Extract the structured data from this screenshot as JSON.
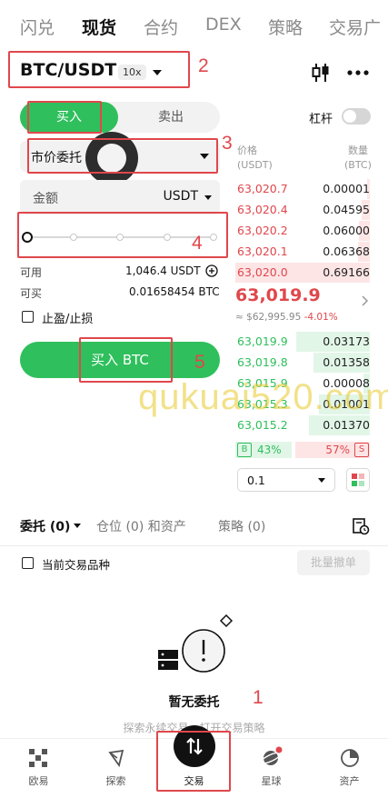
{
  "top_tabs": [
    "闪兑",
    "现货",
    "合约",
    "DEX",
    "策略",
    "交易广"
  ],
  "pair": {
    "symbol": "BTC/USDT",
    "leverage": "10x"
  },
  "header_toggle_label": "杠杆",
  "side": {
    "buy": "买入",
    "sell": "卖出"
  },
  "order_type": "市价委托",
  "amount": {
    "label": "金额",
    "unit": "USDT"
  },
  "slider": {
    "level_percent": 0
  },
  "available": {
    "label": "可用",
    "value": "1,046.4 USDT"
  },
  "can_buy": {
    "label": "可买",
    "value": "0.01658454 BTC"
  },
  "tp_sl": "止盈/止损",
  "buy_button": "买入 BTC",
  "order_book": {
    "price_header": "价格",
    "price_unit": "(USDT)",
    "qty_header": "数量",
    "qty_unit": "(BTC)",
    "asks": [
      {
        "price": "63,020.7",
        "qty": "0.00001",
        "depth": 0.02
      },
      {
        "price": "63,020.4",
        "qty": "0.04595",
        "depth": 0.06
      },
      {
        "price": "63,020.2",
        "qty": "0.06000",
        "depth": 0.08
      },
      {
        "price": "63,020.1",
        "qty": "0.06368",
        "depth": 0.09
      },
      {
        "price": "63,020.0",
        "qty": "0.69166",
        "depth": 1.0
      }
    ],
    "last_price": "63,019.9",
    "fiat_price": "≈ $62,995.95",
    "change": "-4.01%",
    "bids": [
      {
        "price": "63,019.9",
        "qty": "0.03173",
        "depth": 0.55
      },
      {
        "price": "63,019.8",
        "qty": "0.01358",
        "depth": 0.42
      },
      {
        "price": "63,015.9",
        "qty": "0.00008",
        "depth": 0.05
      },
      {
        "price": "63,015.3",
        "qty": "0.01001",
        "depth": 0.38
      },
      {
        "price": "63,015.2",
        "qty": "0.01370",
        "depth": 0.45
      }
    ],
    "buy_ratio_label": "B",
    "buy_ratio": "43%",
    "sell_ratio": "57%",
    "sell_ratio_label": "S",
    "depth_step": "0.1"
  },
  "lower_tabs": {
    "orders": "委托 (0)",
    "positions": "仓位 (0) 和资产",
    "strategy": "策略 (0)"
  },
  "current_pair_only": "当前交易品种",
  "batch_cancel": "批量撤单",
  "empty": {
    "title": "暂无委托",
    "subtitle": "探索永续交易，打开交易策略"
  },
  "bottom_nav": [
    "欧易",
    "探索",
    "交易",
    "星球",
    "资产"
  ],
  "annotations": [
    "1",
    "2",
    "3",
    "4",
    "5"
  ],
  "watermark": "qukuai520.com",
  "colors": {
    "buy_green": "#2fbf5c",
    "sell_red": "#e0474c",
    "annotation_red": "#e0474c"
  }
}
